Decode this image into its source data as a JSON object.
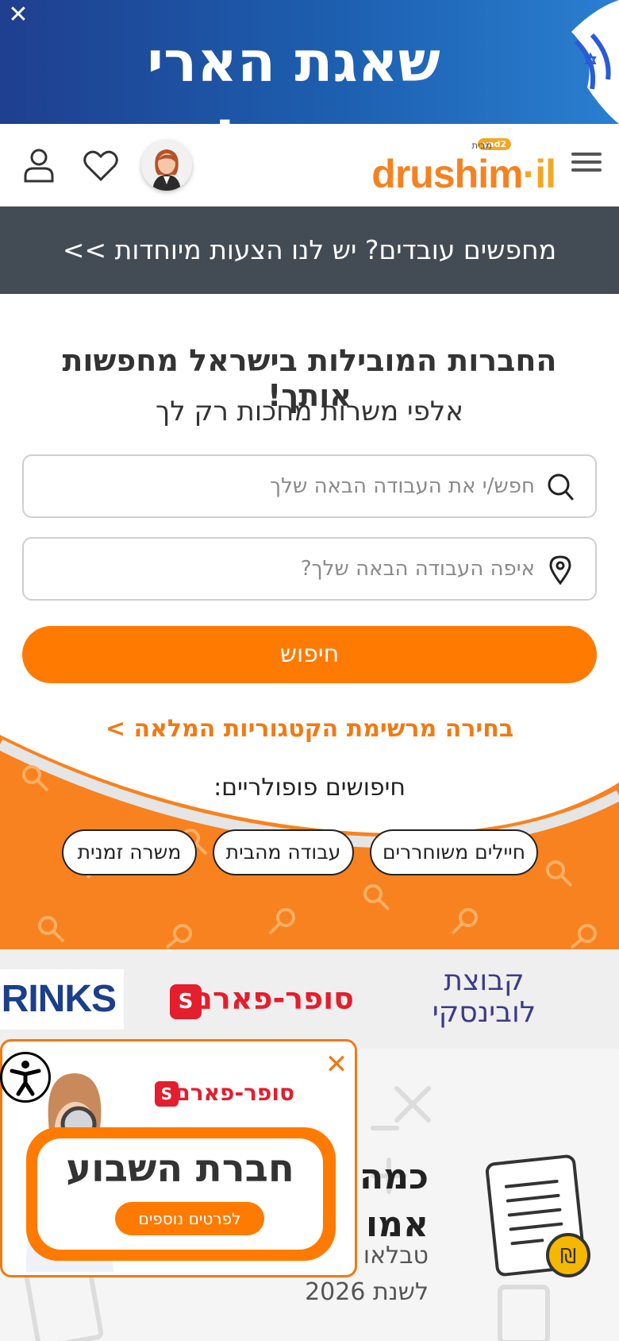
{
  "banner": {
    "close_label": "✕",
    "text": "שאגת הארי תנצח!",
    "flag": "israel-flag-icon"
  },
  "header": {
    "menu_icon": "hamburger-icon",
    "logo_main": "drushim",
    "logo_il": "il",
    "logo_sub": "מבית",
    "logo_badge": "yad2",
    "icons": [
      "avatar",
      "heart-icon",
      "user-icon"
    ]
  },
  "promo_bar": {
    "text": "מחפשים עובדים? יש לנו הצעות מיוחדות >>"
  },
  "hero": {
    "title": "החברות המובילות בישראל מחפשות אותך!",
    "subtitle": "אלפי משרות מחכות רק לך",
    "what_placeholder": "חפש/י את העבודה הבאה שלך",
    "where_placeholder": "איפה העבודה הבאה שלך?",
    "search_button": "חיפוש",
    "categories_link": "בחירה מרשימת הקטגוריות המלאה >",
    "popular_title": "חיפושים פופולריים:",
    "chips": [
      "חיילים משוחררים",
      "עבודה מהבית",
      "משרה זמנית"
    ]
  },
  "logos": {
    "brinks": "RINKS",
    "superpharm": "סופר-פארם",
    "lubinski_line1": "קבוצת",
    "lubinski_line2": "לובינסקי"
  },
  "article": {
    "title_line1": "כמה",
    "title_line2": "אמו",
    "text_line1": "טבלאו",
    "text_line2": "לשנת 2026",
    "icon": "document-shekel-icon"
  },
  "popup": {
    "close_label": "✕",
    "brand": "סופר-פארם",
    "headline": "חברת השבוע",
    "button": "לפרטים נוספים"
  },
  "colors": {
    "accent": "#ff7a00",
    "dark_bar": "#434b54",
    "banner": "#1d5fb0",
    "superpharm": "#e31e2d"
  }
}
